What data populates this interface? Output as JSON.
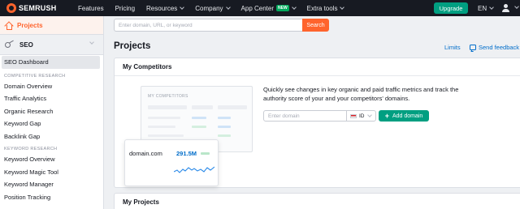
{
  "topnav": {
    "logo_text": "SEMRUSH",
    "items": [
      {
        "label": "Features"
      },
      {
        "label": "Pricing"
      },
      {
        "label": "Resources"
      },
      {
        "label": "Company"
      },
      {
        "label": "App Center"
      },
      {
        "label": "Extra tools"
      }
    ],
    "app_center_badge": "NEW",
    "upgrade_label": "Upgrade",
    "language": "EN"
  },
  "sidebar": {
    "projects_label": "Projects",
    "seo_label": "SEO",
    "dashboard_label": "SEO Dashboard",
    "competitive_section": "COMPETITIVE RESEARCH",
    "competitive_items": [
      {
        "label": "Domain Overview"
      },
      {
        "label": "Traffic Analytics"
      },
      {
        "label": "Organic Research"
      },
      {
        "label": "Keyword Gap"
      },
      {
        "label": "Backlink Gap"
      }
    ],
    "keyword_section": "KEYWORD RESEARCH",
    "keyword_items": [
      {
        "label": "Keyword Overview"
      },
      {
        "label": "Keyword Magic Tool"
      },
      {
        "label": "Keyword Manager"
      },
      {
        "label": "Position Tracking"
      }
    ]
  },
  "search": {
    "placeholder": "Enter domain, URL, or keyword",
    "button_label": "Search"
  },
  "page": {
    "title": "Projects",
    "limits_label": "Limits",
    "feedback_label": "Send feedback"
  },
  "competitors_card": {
    "title": "My Competitors",
    "illustration": {
      "mock_title": "MY COMPETITORS",
      "domain": "domain.com",
      "value": "291.5M"
    },
    "description": "Quickly see changes in key organic and paid traffic metrics and track the authority score of your and your competitors' domains.",
    "domain_placeholder": "Enter domain",
    "country": "ID",
    "add_button_label": "Add domain"
  },
  "projects_card": {
    "title": "My Projects"
  },
  "colors": {
    "brand_orange": "#ff642d",
    "green": "#009f81",
    "link_blue": "#006dca",
    "nav_dark": "#171a22"
  }
}
